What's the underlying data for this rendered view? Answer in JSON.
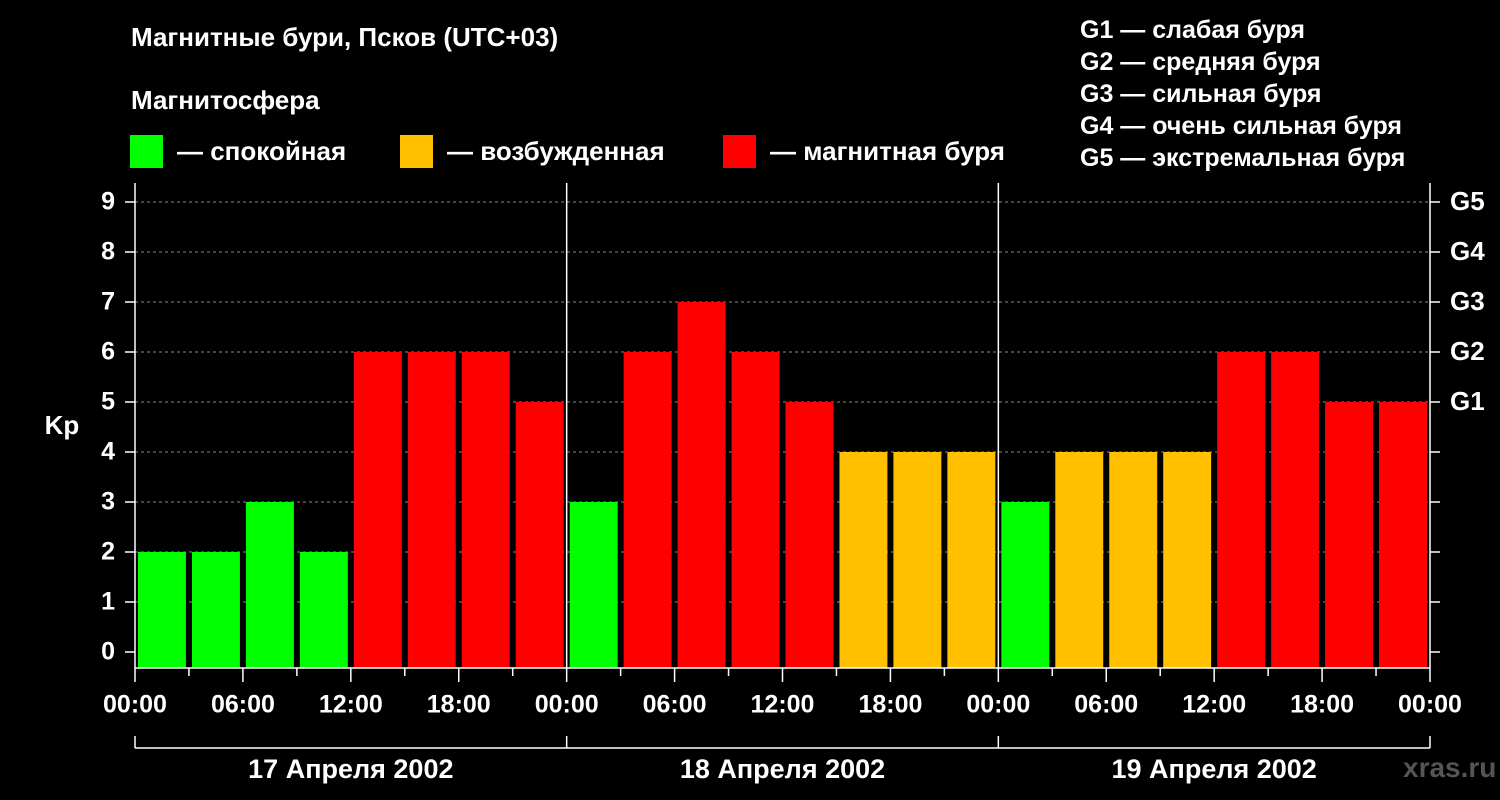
{
  "title": "Магнитные бури, Псков (UTC+03)",
  "subtitle": "Магнитосфера",
  "legend": [
    {
      "label": "— спокойная",
      "color": "#00ff00"
    },
    {
      "label": "— возбужденная",
      "color": "#ffc000"
    },
    {
      "label": "— магнитная буря",
      "color": "#ff0000"
    }
  ],
  "g_scale": [
    "G1 — слабая буря",
    "G2 — средняя буря",
    "G3 — сильная буря",
    "G4 — очень сильная буря",
    "G5 — экстремальная буря"
  ],
  "watermark": "xras.ru",
  "chart_data": {
    "type": "bar",
    "ylabel": "Kp",
    "ylim": [
      0,
      9
    ],
    "yticks": [
      "0",
      "1",
      "2",
      "3",
      "4",
      "5",
      "6",
      "7",
      "8",
      "9"
    ],
    "right_ticks": [
      {
        "kp": 5,
        "label": "G1"
      },
      {
        "kp": 6,
        "label": "G2"
      },
      {
        "kp": 7,
        "label": "G3"
      },
      {
        "kp": 8,
        "label": "G4"
      },
      {
        "kp": 9,
        "label": "G5"
      }
    ],
    "grid": true,
    "x_tick_labels": [
      "00:00",
      "06:00",
      "12:00",
      "18:00",
      "00:00",
      "06:00",
      "12:00",
      "18:00",
      "00:00",
      "06:00",
      "12:00",
      "18:00",
      "00:00"
    ],
    "days": [
      "17 Апреля 2002",
      "18 Апреля 2002",
      "19 Апреля 2002"
    ],
    "values": [
      2,
      2,
      3,
      2,
      6,
      6,
      6,
      5,
      3,
      6,
      7,
      6,
      5,
      4,
      4,
      4,
      3,
      4,
      4,
      4,
      6,
      6,
      5,
      5
    ],
    "colors": {
      "quiet": "#00ff00",
      "active": "#ffc000",
      "storm": "#ff0000"
    }
  }
}
